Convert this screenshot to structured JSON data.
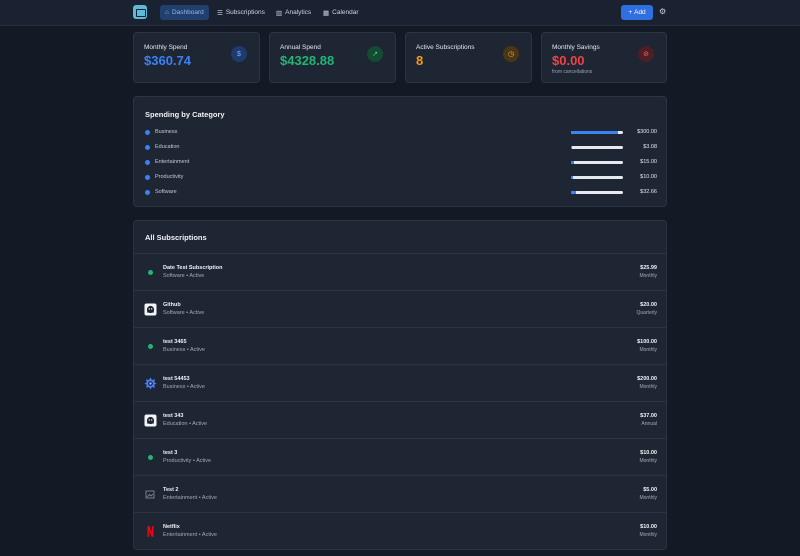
{
  "nav": {
    "items": [
      {
        "label": "Dashboard",
        "icon": "home-icon",
        "active": true
      },
      {
        "label": "Subscriptions",
        "icon": "list-icon",
        "active": false
      },
      {
        "label": "Analytics",
        "icon": "chart-icon",
        "active": false
      },
      {
        "label": "Calendar",
        "icon": "calendar-icon",
        "active": false
      }
    ],
    "add_label": "Add"
  },
  "stats": [
    {
      "label": "Monthly Spend",
      "value": "$360.74",
      "color": "#3b82f6",
      "sub": "",
      "icon": "dollar-icon"
    },
    {
      "label": "Annual Spend",
      "value": "$4328.88",
      "color": "#22b573",
      "sub": "",
      "icon": "trend-up-icon"
    },
    {
      "label": "Active Subscriptions",
      "value": "8",
      "color": "#f59e0b",
      "sub": "",
      "icon": "clock-icon"
    },
    {
      "label": "Monthly Savings",
      "value": "$0.00",
      "color": "#ef4444",
      "sub": "from cancellations",
      "icon": "stop-icon"
    }
  ],
  "categories": {
    "title": "Spending by Category",
    "items": [
      {
        "name": "Business",
        "amount": "$300.00",
        "fraction": 0.91
      },
      {
        "name": "Education",
        "amount": "$3.08",
        "fraction": 0.01
      },
      {
        "name": "Entertainment",
        "amount": "$15.00",
        "fraction": 0.05
      },
      {
        "name": "Productivity",
        "amount": "$10.00",
        "fraction": 0.03
      },
      {
        "name": "Software",
        "amount": "$32.66",
        "fraction": 0.1
      }
    ]
  },
  "subscriptions": {
    "title": "All Subscriptions",
    "items": [
      {
        "name": "Date Test Subscription",
        "meta": "Software • Active",
        "price": "$25.99",
        "cycle": "Monthly",
        "icon": "status-dot-icon"
      },
      {
        "name": "Github",
        "meta": "Software • Active",
        "price": "$20.00",
        "cycle": "Quarterly",
        "icon": "github-logo-icon"
      },
      {
        "name": "test 3465",
        "meta": "Business • Active",
        "price": "$100.00",
        "cycle": "Monthly",
        "icon": "status-dot-icon"
      },
      {
        "name": "test 54453",
        "meta": "Business • Active",
        "price": "$200.00",
        "cycle": "Monthly",
        "icon": "badge-logo-icon"
      },
      {
        "name": "test 343",
        "meta": "Education • Active",
        "price": "$37.00",
        "cycle": "Annual",
        "icon": "github-logo-icon"
      },
      {
        "name": "test 3",
        "meta": "Productivity • Active",
        "price": "$10.00",
        "cycle": "Monthly",
        "icon": "status-dot-icon"
      },
      {
        "name": "Test 2",
        "meta": "Entertainment • Active",
        "price": "$5.00",
        "cycle": "Monthly",
        "icon": "broken-image-icon"
      },
      {
        "name": "Netflix",
        "meta": "Entertainment • Active",
        "price": "$10.00",
        "cycle": "Monthly",
        "icon": "netflix-logo-icon"
      }
    ]
  }
}
